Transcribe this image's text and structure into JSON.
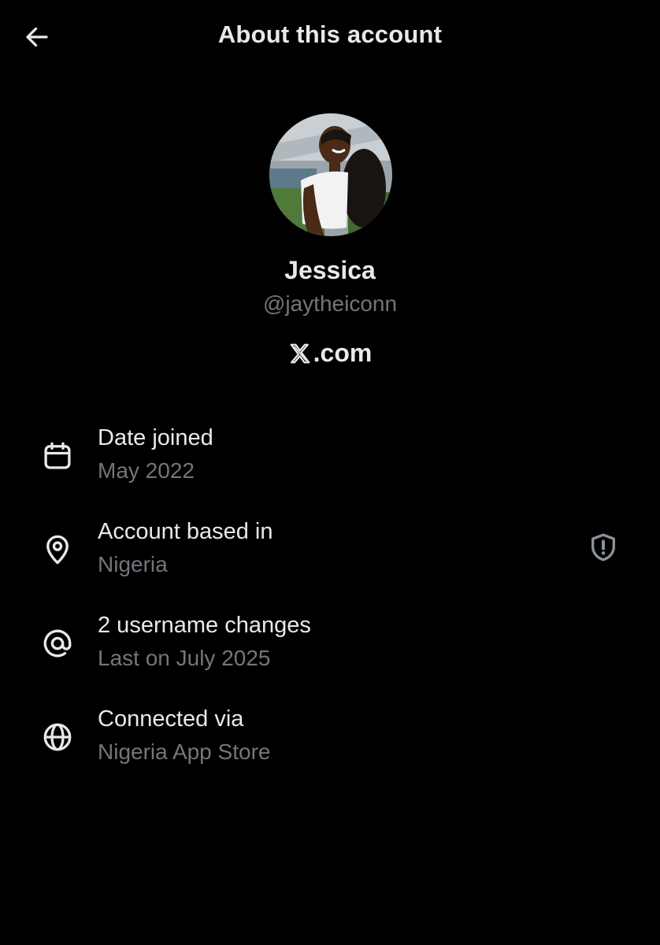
{
  "header": {
    "title": "About this account",
    "back_icon": "arrow-left-icon"
  },
  "profile": {
    "name": "Jessica",
    "handle": "@jaytheiconn",
    "platform": ".com",
    "platform_logo": "x-logo-icon"
  },
  "details": [
    {
      "icon": "calendar-icon",
      "title": "Date joined",
      "value": "May 2022"
    },
    {
      "icon": "location-pin-icon",
      "title": "Account based in",
      "value": "Nigeria",
      "badge_icon": "shield-exclamation-icon"
    },
    {
      "icon": "at-sign-icon",
      "title": "2 username changes",
      "value": "Last on July 2025"
    },
    {
      "icon": "globe-icon",
      "title": "Connected via",
      "value": "Nigeria App Store"
    }
  ],
  "colors": {
    "background": "#000000",
    "primary_text": "#e7e9ea",
    "secondary_text": "#71767b"
  }
}
